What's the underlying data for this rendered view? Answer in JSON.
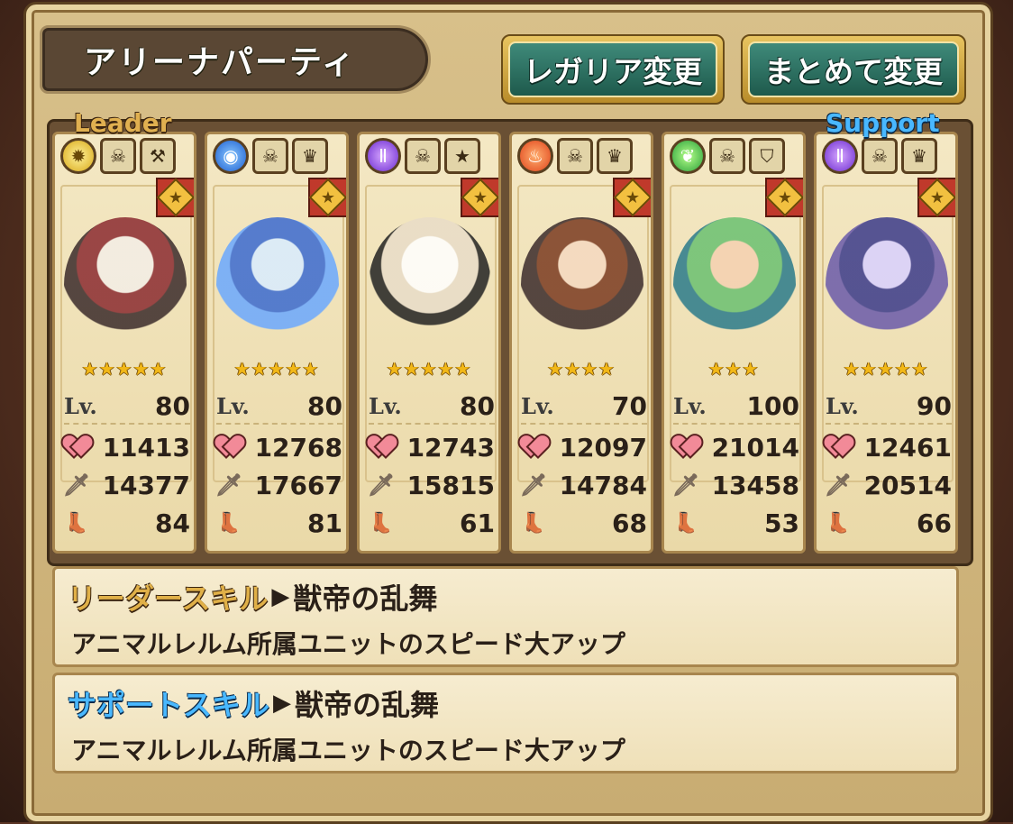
{
  "title": "アリーナパーティ",
  "buttons": {
    "regalia": "レガリア変更",
    "bulk": "まとめて変更"
  },
  "labels": {
    "leader": "Leader",
    "support": "Support",
    "lv": "Lv."
  },
  "units": [
    {
      "attribute": "gold",
      "icons": [
        "gear-icon",
        "skull-icon",
        "wrench-icon"
      ],
      "stars": "★★★★★",
      "lv": "80",
      "hp": "11413",
      "atk": "14377",
      "spd": "84"
    },
    {
      "attribute": "blue",
      "icons": [
        "water-icon",
        "skull-icon",
        "crown-icon"
      ],
      "stars": "★★★★★",
      "lv": "80",
      "hp": "12768",
      "atk": "17667",
      "spd": "81"
    },
    {
      "attribute": "purple",
      "icons": [
        "dark-icon",
        "skull-icon",
        "star-icon"
      ],
      "stars": "★★★★★",
      "lv": "80",
      "hp": "12743",
      "atk": "15815",
      "spd": "61"
    },
    {
      "attribute": "red",
      "icons": [
        "fire-icon",
        "skull-icon",
        "crown-icon"
      ],
      "stars": "★★★★",
      "lv": "70",
      "hp": "12097",
      "atk": "14784",
      "spd": "68"
    },
    {
      "attribute": "green",
      "icons": [
        "leaf-icon",
        "skull-icon",
        "shield-icon"
      ],
      "stars": "★★★",
      "lv": "100",
      "hp": "21014",
      "atk": "13458",
      "spd": "53"
    },
    {
      "attribute": "purple",
      "icons": [
        "dark-icon",
        "skull-icon",
        "crown-icon"
      ],
      "stars": "★★★★★",
      "lv": "90",
      "hp": "12461",
      "atk": "20514",
      "spd": "66"
    }
  ],
  "leader_skill": {
    "tag": "リーダースキル",
    "arrow": "▶",
    "name": "獣帝の乱舞",
    "desc": "アニマルレルム所属ユニットのスピード大アップ"
  },
  "support_skill": {
    "tag": "サポートスキル",
    "arrow": "▶",
    "name": "獣帝の乱舞",
    "desc": "アニマルレルム所属ユニットのスピード大アップ"
  },
  "colors": {
    "leader": "#e0b048",
    "support": "#49b8ff",
    "button": "#1e5a4c",
    "star": "#f2b818"
  }
}
